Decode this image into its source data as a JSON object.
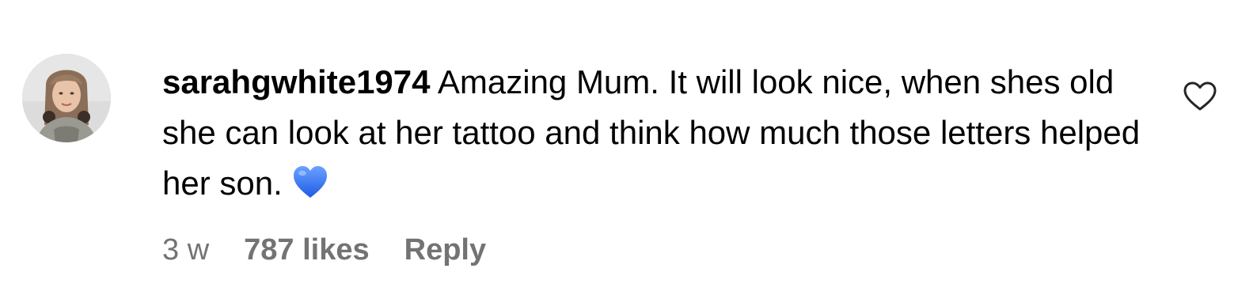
{
  "comment": {
    "avatar_icon": "profile-photo",
    "username": "sarahgwhite1974",
    "text": "Amazing Mum. It will look nice, when shes old she can look at her tattoo and think how much those letters helped her son.",
    "emoji": "blue-heart-emoji",
    "time": "3 w",
    "likes": "787 likes",
    "reply_label": "Reply",
    "like_icon": "heart-outline-icon"
  },
  "colors": {
    "text": "#000000",
    "meta": "#737373",
    "emoji_blue": "#2f6cf0"
  }
}
